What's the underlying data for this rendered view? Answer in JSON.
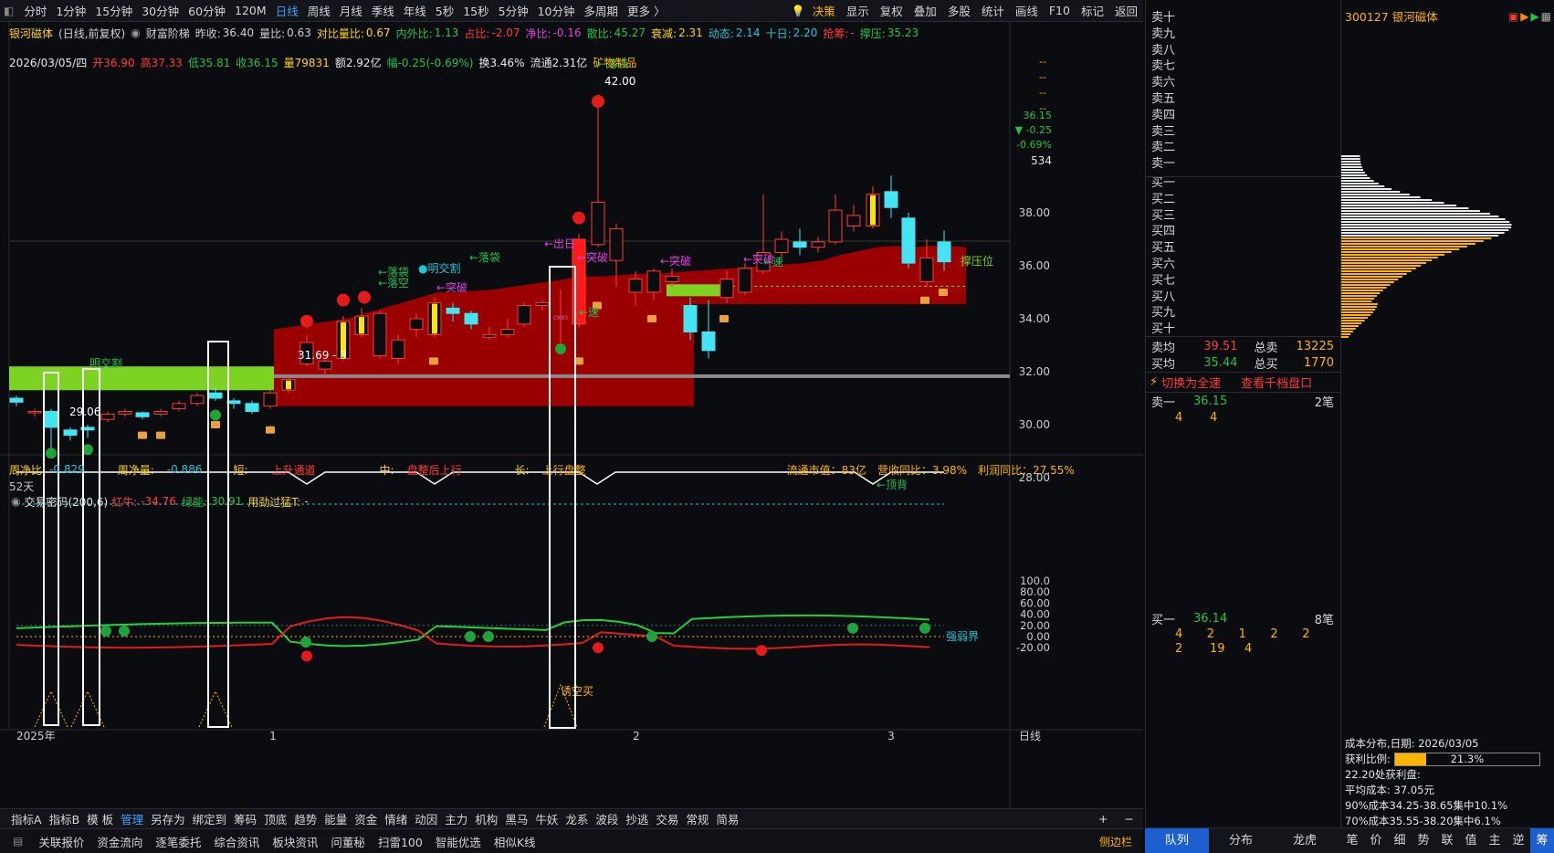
{
  "toolbar": {
    "periods": [
      "分时",
      "1分钟",
      "15分钟",
      "30分钟",
      "60分钟",
      "120M",
      "日线",
      "周线",
      "月线",
      "季线",
      "年线",
      "5秒",
      "15秒",
      "5分钟",
      "10分钟",
      "多周期",
      "更多 〉"
    ],
    "active_period": "日线",
    "right_items": [
      "决策",
      "显示",
      "复权",
      "叠加",
      "多股",
      "统计",
      "画线",
      "F10",
      "标记",
      "返回"
    ]
  },
  "stock": {
    "name": "银河磁体",
    "mode": "(日线,前复权)",
    "indicator": "财富阶梯",
    "code": "300127",
    "header_code_name": "300127 银河磁体"
  },
  "info_row1": [
    {
      "label": "昨收:",
      "value": "36.40",
      "color": "#d0d0d0"
    },
    {
      "label": "量比:",
      "value": "0.63",
      "color": "#d0d0d0"
    },
    {
      "label": "对比量比:",
      "value": "0.67",
      "color": "#ffd21f"
    },
    {
      "label": "内外比:",
      "value": "1.13",
      "color": "#22c14a"
    },
    {
      "label": "占比:",
      "value": "-2.07",
      "color": "#ff3b3b"
    },
    {
      "label": "净比:",
      "value": "-0.16",
      "color": "#e040e0"
    },
    {
      "label": "散比:",
      "value": "45.27",
      "color": "#22c14a"
    },
    {
      "label": "衰减:",
      "value": "2.31",
      "color": "#ffd21f"
    },
    {
      "label": "动态:",
      "value": "2.14",
      "color": "#21c6d6"
    },
    {
      "label": "十日:",
      "value": "2.20",
      "color": "#21c6d6"
    },
    {
      "label": "抢筹:",
      "value": "-",
      "color": "#ff3b3b"
    },
    {
      "label": "撑压:",
      "value": "35.23",
      "color": "#22c14a"
    }
  ],
  "info_row2": {
    "date": "2026/03/05/四",
    "open": "开36.90",
    "high": "高37.33",
    "low": "低35.81",
    "close": "收36.15",
    "volume": "量79831",
    "amount": "额2.92亿",
    "change": "幅-0.25(-0.69%)",
    "turnover": "换3.46%",
    "float": "流通2.31亿",
    "industry": "矿物制品"
  },
  "price_axis": {
    "ticks": [
      "38.00",
      "36.00",
      "34.00",
      "32.00",
      "30.00",
      "28.00"
    ],
    "top_dashes": [
      "--",
      "--",
      "--",
      "--"
    ],
    "last_price": "36.15",
    "change": "▼ -0.25",
    "change_pct": "-0.69%",
    "volume_mark": "534"
  },
  "annotations": {
    "high_label": "42.00",
    "low_label": "29.06",
    "support_label": "撑压位",
    "mingjiao": "明交割",
    "mingjiao2": "●明交割",
    "luodai": "←落袋",
    "luodai2": "←落袋",
    "luodai_top": "←落袋",
    "luodai_ling": "←落空",
    "tupo": "←突破",
    "tupo2": "←突破",
    "tupo3": "←突破",
    "tupo4": "←突破",
    "chuyi": "←出日",
    "su": "←速",
    "su2": "←速",
    "price_tag": "31.69 - 3",
    "zhao": "招",
    "low_arrow": "←"
  },
  "trend_row": {
    "week_net_label": "周净比:",
    "week_net": "-0.829",
    "week_vol_label": "周净量:",
    "week_vol": "-0.886",
    "short_label": "短:",
    "short": "上升通道",
    "mid_label": "中:",
    "mid": "盘整后上行",
    "long_label": "长:",
    "long": "上行盘整",
    "mkt_cap": "流通市值：83亿",
    "rev_yoy": "营收同比：3.98%",
    "profit_yoy": "利润同比：27.55%",
    "days": "52天"
  },
  "indicator_panel": {
    "name": "交易密码(200,6)",
    "red_label": "红牛:",
    "red_value": "-34.76",
    "green_label": "绿能:",
    "green_value": "30.91",
    "used_label": "用劲过猛T:",
    "used_value": "-",
    "top_div": "←顶背",
    "axis": [
      "100.0",
      "80.00",
      "60.00",
      "40.00",
      "20.00",
      "0.00",
      "-20.00"
    ],
    "strength_label": "强弱界",
    "lure_label": "诱空买"
  },
  "x_axis": {
    "labels": [
      "2025年",
      "1",
      "2",
      "3"
    ],
    "period": "日线"
  },
  "indicator_tabs": [
    "指标A",
    "指标B",
    "模 板",
    "管理",
    "另存为",
    "绑定到",
    "筹码",
    "顶底",
    "趋势",
    "能量",
    "资金",
    "情绪",
    "动因",
    "主力",
    "机构",
    "黑马",
    "牛妖",
    "龙系",
    "波段",
    "抄逃",
    "交易",
    "常规",
    "简易"
  ],
  "indicator_tabs_active": "管理",
  "bottom_tabs": [
    "关联报价",
    "资金流向",
    "逐笔委托",
    "综合资讯",
    "板块资讯",
    "问董秘",
    "扫雷100",
    "智能优选",
    "相似K线"
  ],
  "side_bar": "侧边栏",
  "order_book": {
    "asks": [
      "卖十",
      "卖九",
      "卖八",
      "卖七",
      "卖六",
      "卖五",
      "卖四",
      "卖三",
      "卖二",
      "卖一"
    ],
    "bids": [
      "买一",
      "买二",
      "买三",
      "买四",
      "买五",
      "买六",
      "买七",
      "买八",
      "买九",
      "买十"
    ],
    "ask_avg_label": "卖均",
    "ask_avg": "39.51",
    "total_ask_label": "总卖",
    "total_ask": "13225",
    "bid_avg_label": "买均",
    "bid_avg": "35.44",
    "total_bid_label": "总买",
    "total_bid": "1770",
    "switch_fast": "切换为全速",
    "view_thousand": "查看千档盘口",
    "sell1_label": "卖一",
    "sell1_price": "36.15",
    "sell1_count": "2笔",
    "sell1_queue": [
      "4",
      "4"
    ],
    "buy1_label": "买一",
    "buy1_price": "36.14",
    "buy1_count": "8笔",
    "buy1_queue_row1": [
      "4",
      "2",
      "1",
      "2",
      "2"
    ],
    "buy1_queue_row2": [
      "2",
      "19",
      "4"
    ]
  },
  "cost_panel": {
    "title": "成本分布,日期: 2026/03/05",
    "profit_ratio_label": "获利比例:",
    "profit_ratio": "21.3%",
    "profit_ratio_value": 0.213,
    "profit_line": "22.20处获利盘:",
    "avg_cost": "平均成本:  37.05元",
    "c90": "90%成本34.25-38.65集中10.1%",
    "c70": "70%成本35.55-38.20集中6.1%",
    "bottom_tabs": [
      "笔",
      "价",
      "细",
      "势",
      "联",
      "值",
      "主",
      "逆",
      "筹"
    ],
    "bottom_active": "筹"
  },
  "book_footer": [
    "队列",
    "分布",
    "龙虎"
  ],
  "book_footer_active": "队列",
  "colors": {
    "up": "#ff3b3b",
    "down": "#44e4f2",
    "ladder": "#9b0000",
    "green_zone": "#7dd321",
    "accent": "#3ea0ff",
    "gold": "#ffb400"
  }
}
